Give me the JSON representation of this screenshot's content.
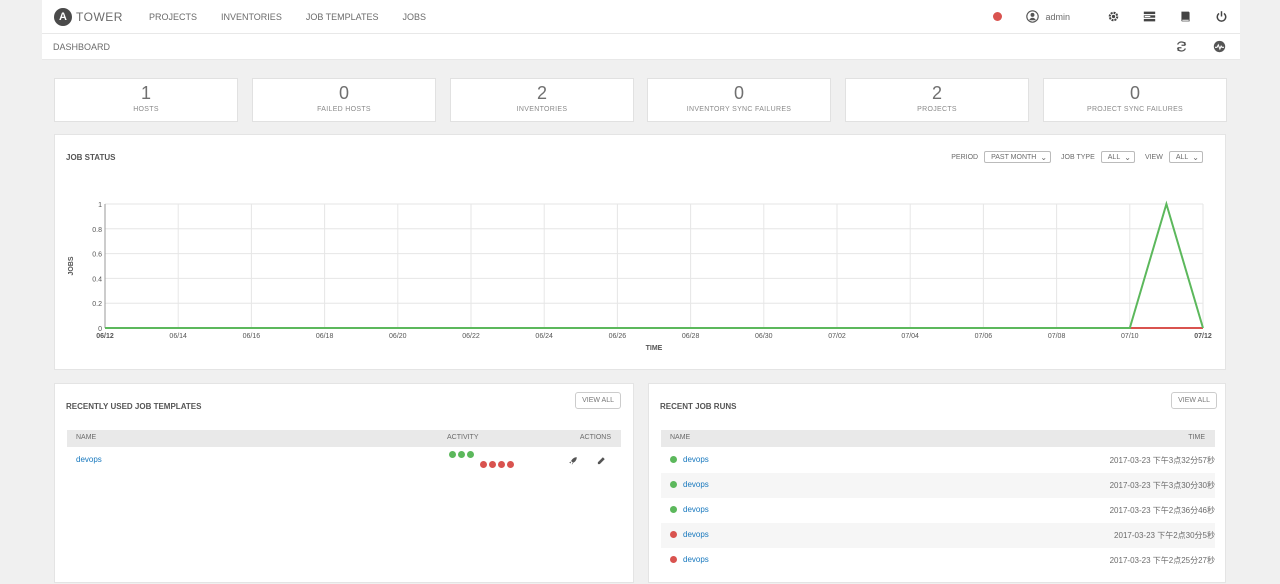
{
  "nav": {
    "brand": "TOWER",
    "logo_letter": "A",
    "links": [
      "PROJECTS",
      "INVENTORIES",
      "JOB TEMPLATES",
      "JOBS"
    ],
    "user": "admin"
  },
  "breadcrumb": "DASHBOARD",
  "counts": [
    {
      "value": "1",
      "label": "HOSTS"
    },
    {
      "value": "0",
      "label": "FAILED HOSTS"
    },
    {
      "value": "2",
      "label": "INVENTORIES"
    },
    {
      "value": "0",
      "label": "INVENTORY SYNC FAILURES"
    },
    {
      "value": "2",
      "label": "PROJECTS"
    },
    {
      "value": "0",
      "label": "PROJECT SYNC FAILURES"
    }
  ],
  "job_status": {
    "title": "JOB STATUS",
    "period_label": "PERIOD",
    "period_value": "PAST MONTH",
    "job_type_label": "JOB TYPE",
    "job_type_value": "ALL",
    "view_label": "VIEW",
    "view_value": "ALL"
  },
  "chart_data": {
    "type": "line",
    "xlabel": "TIME",
    "ylabel": "JOBS",
    "ylim": [
      0,
      1
    ],
    "yticks": [
      "0",
      "0.2",
      "0.4",
      "0.6",
      "0.8",
      "1"
    ],
    "x": [
      "06/12",
      "06/13",
      "06/14",
      "06/15",
      "06/16",
      "06/17",
      "06/18",
      "06/19",
      "06/20",
      "06/21",
      "06/22",
      "06/23",
      "06/24",
      "06/25",
      "06/26",
      "06/27",
      "06/28",
      "06/29",
      "06/30",
      "07/01",
      "07/02",
      "07/03",
      "07/04",
      "07/05",
      "07/06",
      "07/07",
      "07/08",
      "07/09",
      "07/10",
      "07/11",
      "07/12"
    ],
    "xticks": [
      "06/12",
      "06/14",
      "06/16",
      "06/18",
      "06/20",
      "06/22",
      "06/24",
      "06/26",
      "06/28",
      "06/30",
      "07/02",
      "07/04",
      "07/06",
      "07/08",
      "07/10",
      "07/12"
    ],
    "series": [
      {
        "color": "#5cb85c",
        "values": [
          0,
          0,
          0,
          0,
          0,
          0,
          0,
          0,
          0,
          0,
          0,
          0,
          0,
          0,
          0,
          0,
          0,
          0,
          0,
          0,
          0,
          0,
          0,
          0,
          0,
          0,
          0,
          0,
          0,
          1,
          0
        ]
      },
      {
        "color": "#d9534f",
        "values": [
          0,
          0,
          0,
          0,
          0,
          0,
          0,
          0,
          0,
          0,
          0,
          0,
          0,
          0,
          0,
          0,
          0,
          0,
          0,
          0,
          0,
          0,
          0,
          0,
          0,
          0,
          0,
          0,
          0,
          0,
          0
        ]
      }
    ],
    "grid": true
  },
  "templates": {
    "title": "RECENTLY USED JOB TEMPLATES",
    "view_all": "VIEW ALL",
    "columns": [
      "NAME",
      "ACTIVITY",
      "ACTIONS"
    ],
    "rows": [
      {
        "name": "devops",
        "activity": [
          "success",
          "success",
          "success",
          "failed",
          "failed",
          "failed",
          "failed"
        ]
      }
    ]
  },
  "runs": {
    "title": "RECENT JOB RUNS",
    "view_all": "VIEW ALL",
    "columns": [
      "NAME",
      "TIME"
    ],
    "rows": [
      {
        "name": "devops",
        "status": "success",
        "time": "2017-03-23 下午3点32分57秒"
      },
      {
        "name": "devops",
        "status": "success",
        "time": "2017-03-23 下午3点30分30秒"
      },
      {
        "name": "devops",
        "status": "success",
        "time": "2017-03-23 下午2点36分46秒"
      },
      {
        "name": "devops",
        "status": "failed",
        "time": "2017-03-23 下午2点30分5秒"
      },
      {
        "name": "devops",
        "status": "failed",
        "time": "2017-03-23 下午2点25分27秒"
      }
    ]
  },
  "colors": {
    "success": "#5cb85c",
    "failed": "#d9534f",
    "link": "#1778be"
  }
}
